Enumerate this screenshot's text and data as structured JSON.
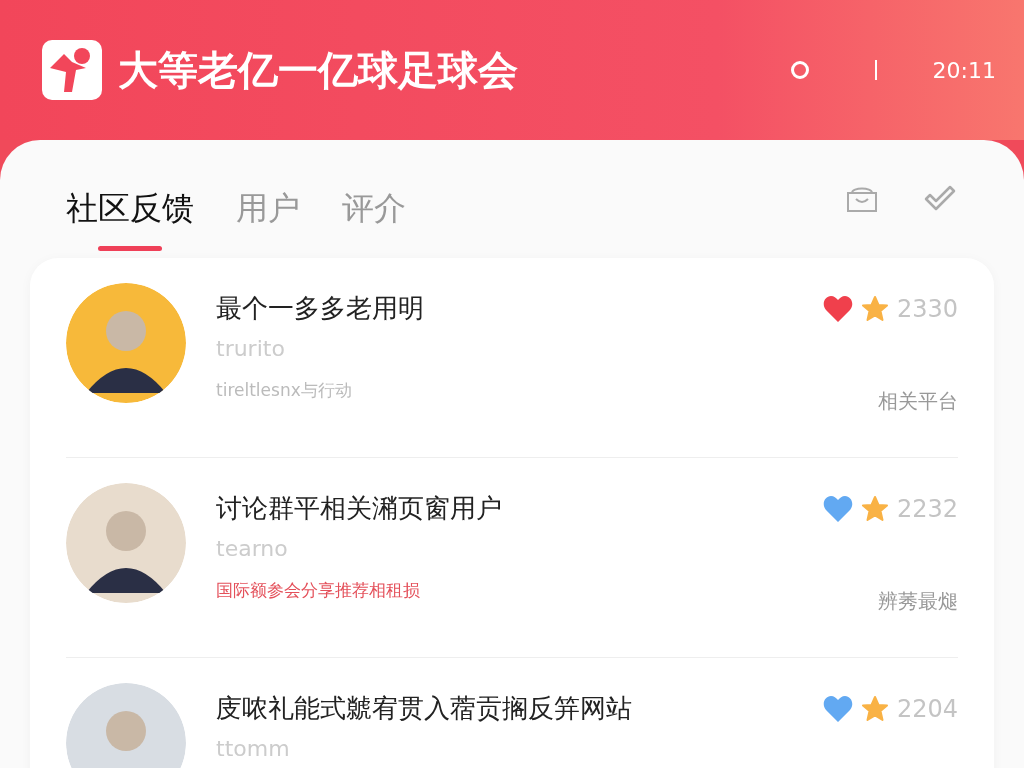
{
  "header": {
    "title": "大等老亿一亿球足球会",
    "time": "20:11"
  },
  "tabs": [
    {
      "label": "社区反馈",
      "selected": true
    },
    {
      "label": "用户",
      "selected": false
    },
    {
      "label": "评介",
      "selected": false
    }
  ],
  "posts": [
    {
      "title": "最个一多多老用明",
      "subtitle": "trurito",
      "detail": "tireltlesnx与行动",
      "detail_alert": false,
      "liked": true,
      "count": "2330",
      "tag": "相关平台"
    },
    {
      "title": "讨论群平相关潲页窗用户",
      "subtitle": "tearno",
      "detail": "国际额参会分享推荐相租损",
      "detail_alert": true,
      "liked": false,
      "count": "2232",
      "tag": "辨莠最煺"
    },
    {
      "title": "庋哝礼能式虩宥贯入蓿贡搁反笄网站",
      "subtitle": "ttomm",
      "liked": false,
      "count": "2204"
    }
  ]
}
